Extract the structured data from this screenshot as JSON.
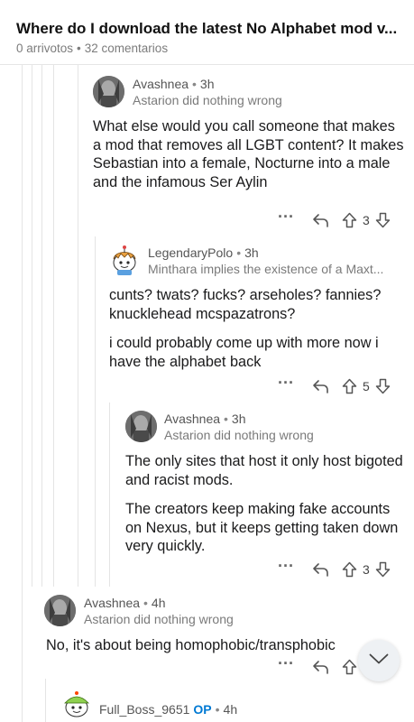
{
  "header": {
    "title": "Where do I download the latest No Alphabet mod v...",
    "votes": "0 arrivotos",
    "comments": "32 comentarios"
  },
  "comments": [
    {
      "user": "Avashnea",
      "age": "3h",
      "flair": "Astarion did nothing wrong",
      "paragraphs": [
        "What else would you call someone that makes a mod that removes all LGBT content?  It makes Sebastian into a female, Nocturne into a male and the infamous Ser Aylin"
      ],
      "score": "3",
      "avatar": "knight-portrait-avatar"
    },
    {
      "user": "LegendaryPolo",
      "age": "3h",
      "flair": "Minthara implies the existence of a Maxt...",
      "paragraphs": [
        "cunts? twats? fucks? arseholes? fannies? knucklehead mcspazatrons?",
        "i could probably come up with more now i have the alphabet back"
      ],
      "score": "5",
      "avatar": "snoo-avatar"
    },
    {
      "user": "Avashnea",
      "age": "3h",
      "flair": "Astarion did nothing wrong",
      "paragraphs": [
        "The only sites that host it only host bigoted and racist mods.",
        "The creators keep making fake accounts on Nexus, but it keeps getting taken down very quickly."
      ],
      "score": "3",
      "avatar": "knight-portrait-avatar"
    },
    {
      "user": "Avashnea",
      "age": "4h",
      "flair": "Astarion did nothing wrong",
      "paragraphs": [
        "No, it's about being homophobic/transphobic"
      ],
      "score": "",
      "avatar": "knight-portrait-avatar"
    },
    {
      "user": "Full_Boss_9651",
      "op_badge": "OP",
      "age": "4h",
      "avatar": "snoo-avatar"
    }
  ],
  "icons": {
    "more": "more-options-icon",
    "reply": "reply-icon",
    "upvote": "upvote-icon",
    "downvote": "downvote-icon",
    "scroll": "chevron-down-icon"
  },
  "colors": {
    "op": "#0079d3",
    "thread_line": "#e4e4e4",
    "text": "#1a1a1b",
    "meta": "#7c7c7c"
  }
}
